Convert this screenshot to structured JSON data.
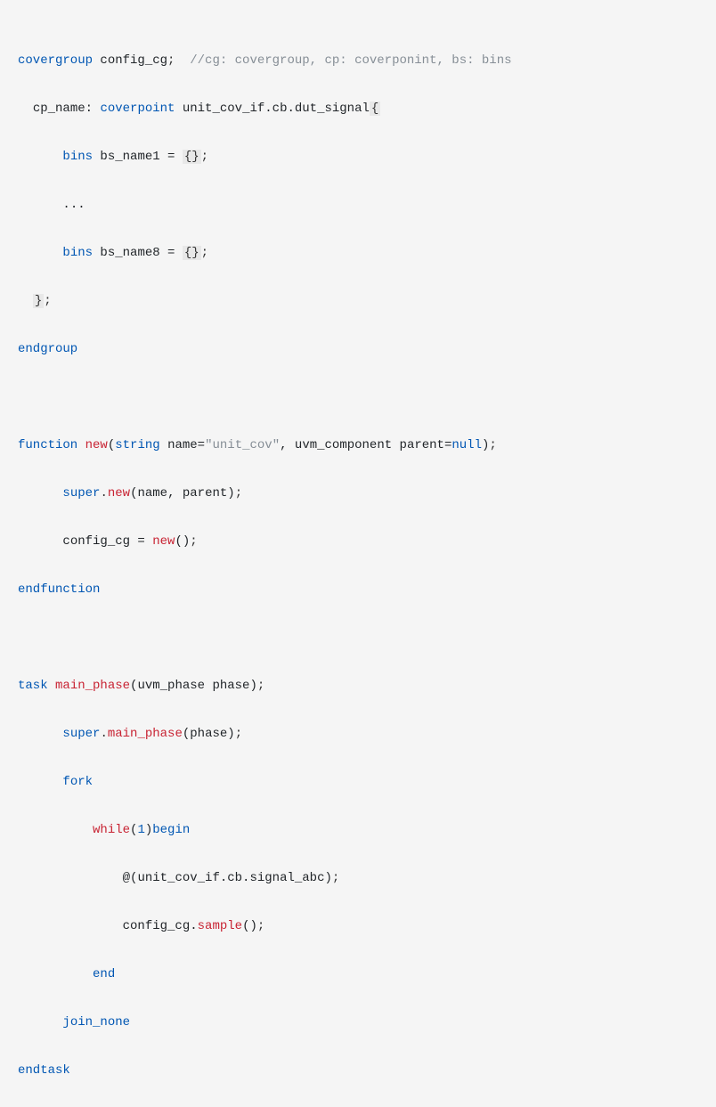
{
  "code": {
    "line1": {
      "kw1": "covergroup",
      "id1": " config_cg",
      "semi": ";",
      "comment": "  //cg: covergroup, cp: coverponint, bs: bins"
    },
    "line2": {
      "indent": "  ",
      "id1": "cp_name: ",
      "kw1": "coverpoint",
      "id2": " unit_cov_if.cb.dut_signal",
      "brace": "{"
    },
    "line3": {
      "indent": "      ",
      "kw1": "bins",
      "id1": " bs_name1 = ",
      "braces": "{}",
      "semi": ";"
    },
    "line4": {
      "indent": "      ",
      "dots": "..."
    },
    "line5": {
      "indent": "      ",
      "kw1": "bins",
      "id1": " bs_name8 = ",
      "braces": "{}",
      "semi": ";"
    },
    "line6": {
      "indent": "  ",
      "brace": "}",
      "semi": ";"
    },
    "line7": {
      "kw1": "endgroup"
    },
    "line8": "",
    "line9": {
      "kw1": "function",
      "sp1": " ",
      "kw2": "new",
      "paren1": "(",
      "kw3": "string",
      "id1": " name=",
      "str": "\"unit_cov\"",
      "comma": ", ",
      "id2": "uvm_component parent=",
      "kw4": "null",
      "paren2": ")",
      "semi": ";"
    },
    "line10": {
      "indent": "      ",
      "kw1": "super",
      "dot": ".",
      "kw2": "new",
      "paren1": "(",
      "id1": "name, parent",
      "paren2": ")",
      "semi": ";"
    },
    "line11": {
      "indent": "      ",
      "id1": "config_cg = ",
      "kw1": "new",
      "parens": "()",
      "semi": ";"
    },
    "line12": {
      "kw1": "endfunction"
    },
    "line13": "",
    "line14": {
      "kw1": "task",
      "sp": " ",
      "kw2": "main_phase",
      "paren1": "(",
      "id1": "uvm_phase phase",
      "paren2": ")",
      "semi": ";"
    },
    "line15": {
      "indent": "      ",
      "kw1": "super",
      "dot": ".",
      "kw2": "main_phase",
      "paren1": "(",
      "id1": "phase",
      "paren2": ")",
      "semi": ";"
    },
    "line16": {
      "indent": "      ",
      "kw1": "fork"
    },
    "line17": {
      "indent": "          ",
      "kw1": "while",
      "paren1": "(",
      "num": "1",
      "paren2": ")",
      "kw2": "begin"
    },
    "line18": {
      "indent": "              ",
      "at": "@",
      "paren1": "(",
      "id1": "unit_cov_if.cb.signal_abc",
      "paren2": ")",
      "semi": ";"
    },
    "line19": {
      "indent": "              ",
      "id1": "config_cg.",
      "kw1": "sample",
      "parens": "()",
      "semi": ";"
    },
    "line20": {
      "indent": "          ",
      "kw1": "end"
    },
    "line21": {
      "indent": "      ",
      "kw1": "join_none"
    },
    "line22": {
      "kw1": "endtask"
    }
  }
}
